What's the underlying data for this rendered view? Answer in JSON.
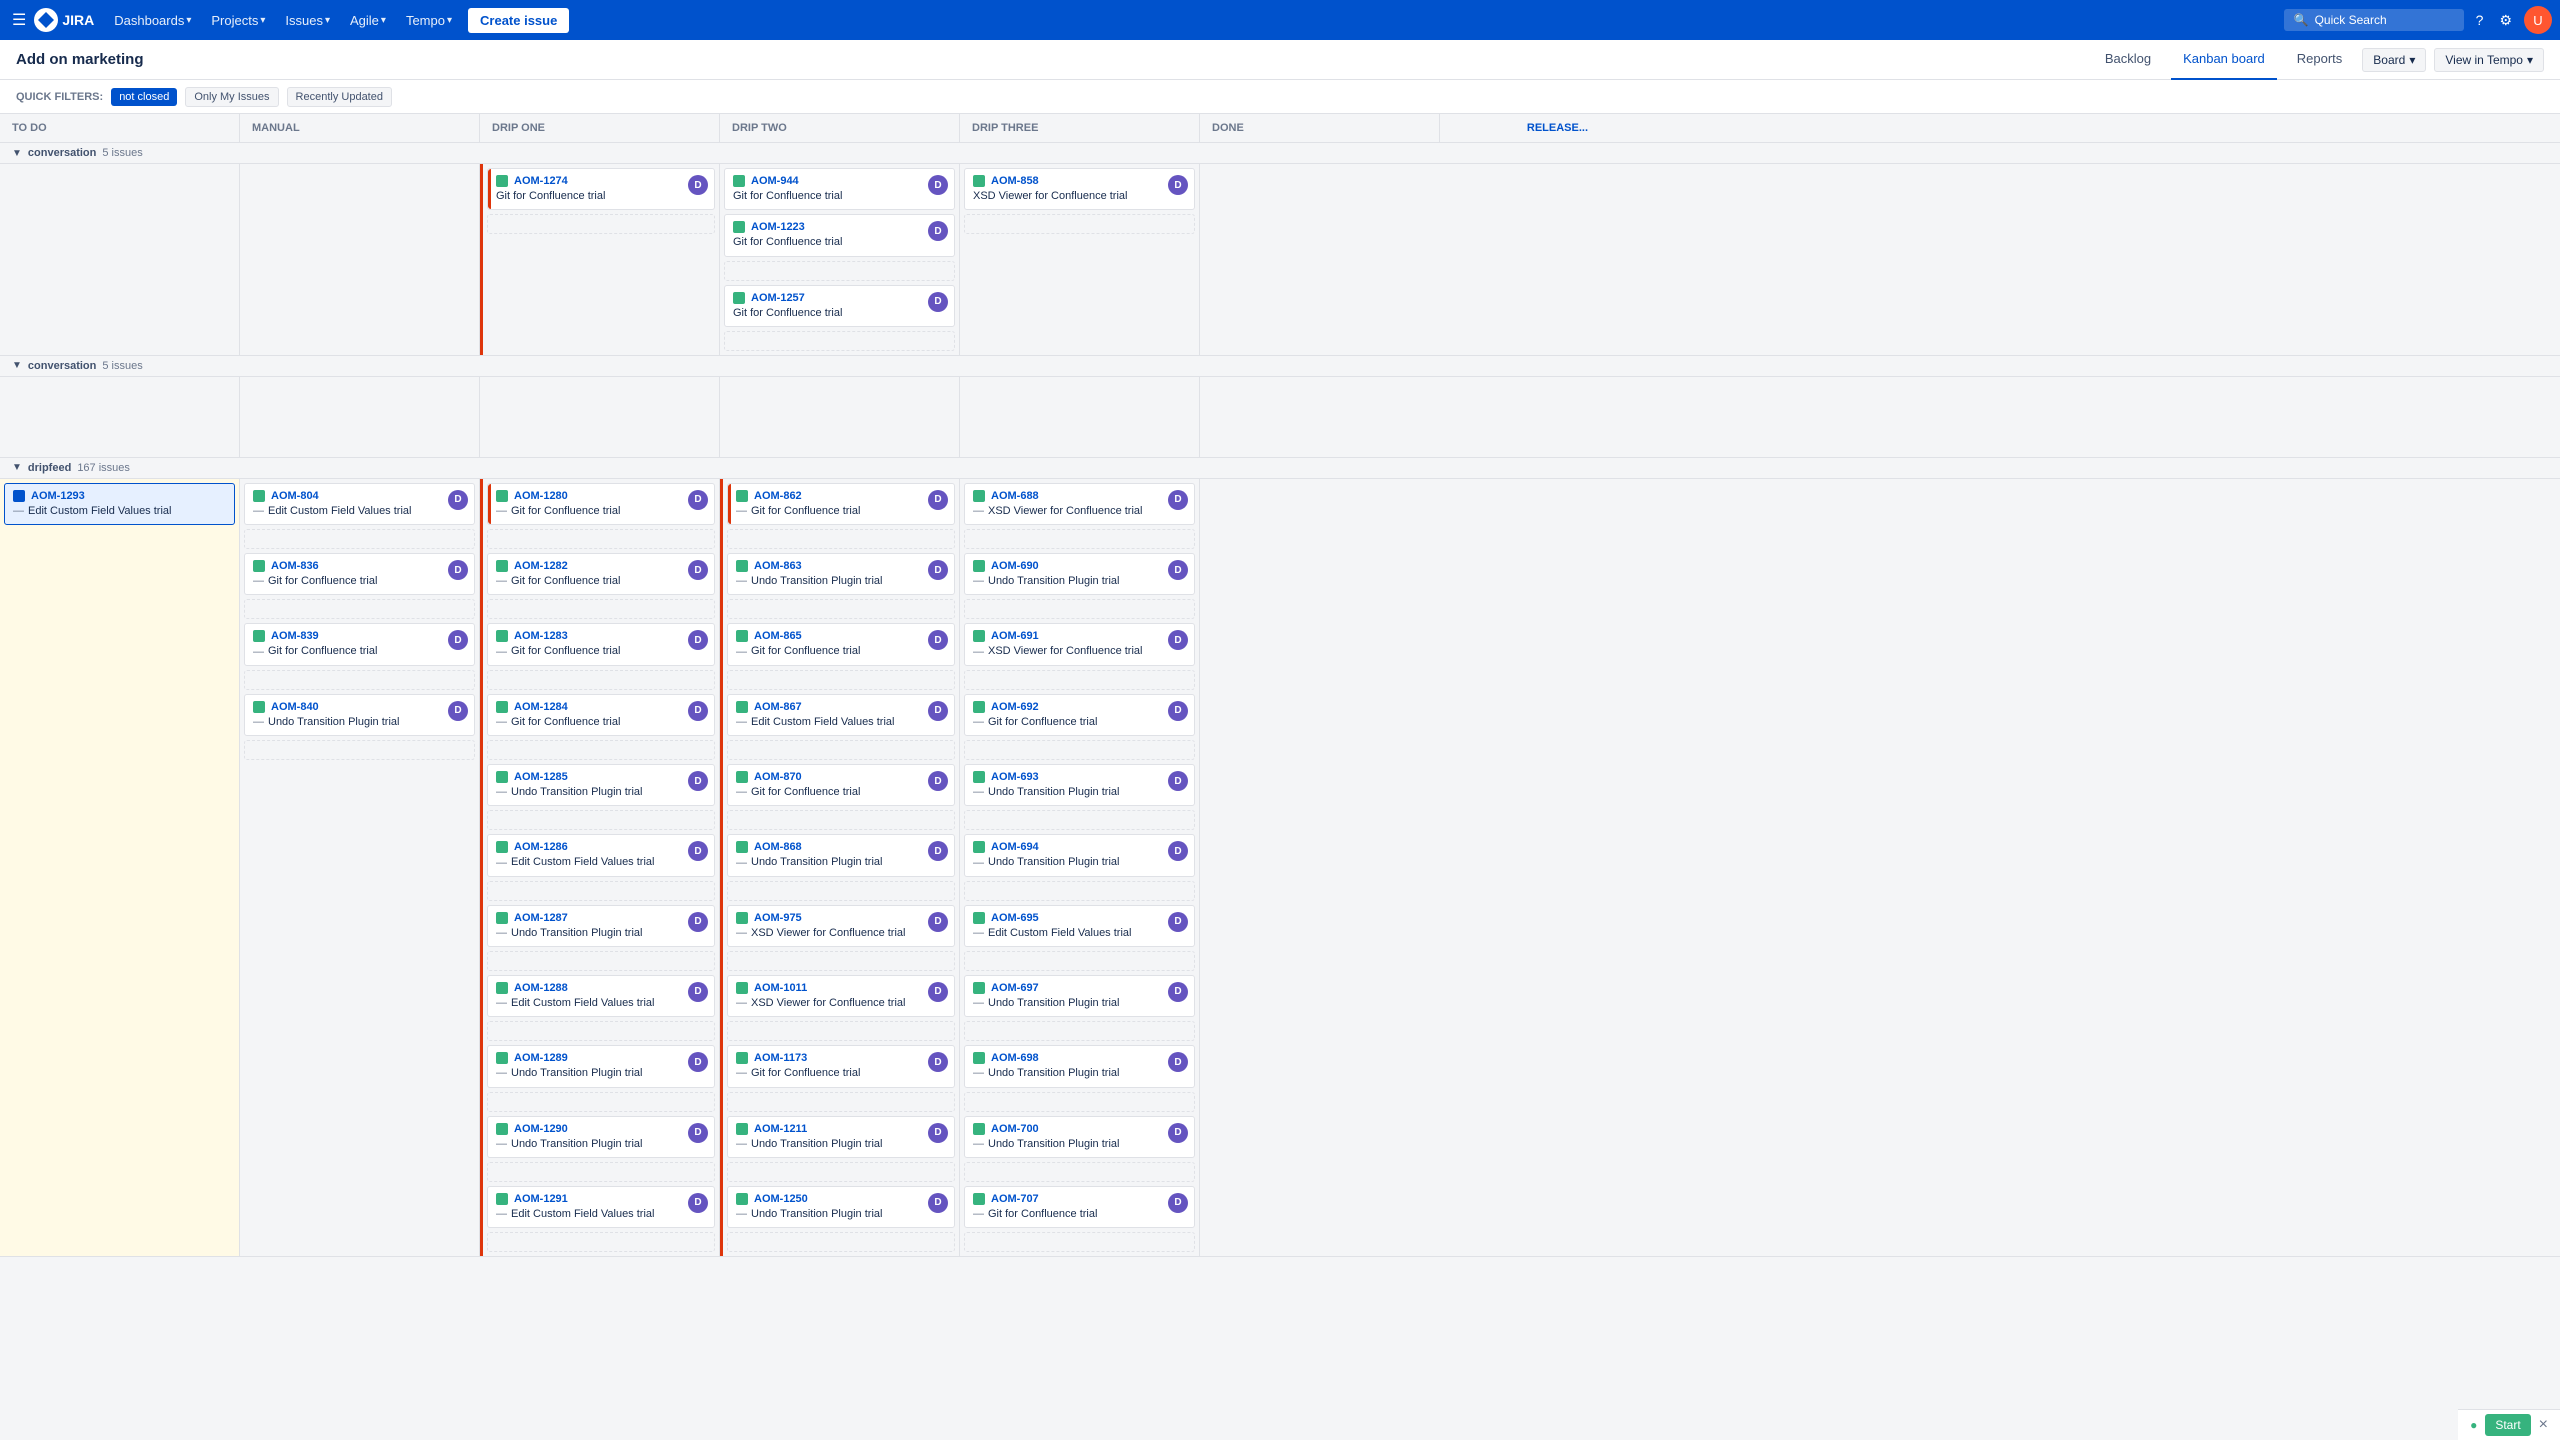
{
  "nav": {
    "logo": "JIRA",
    "dashboards": "Dashboards",
    "projects": "Projects",
    "issues": "Issues",
    "agile": "Agile",
    "tempo": "Tempo",
    "create": "Create issue",
    "search_placeholder": "Quick Search"
  },
  "subNav": {
    "title": "Add on marketing",
    "backlog": "Backlog",
    "kanban": "Kanban board",
    "reports": "Reports",
    "board": "Board",
    "viewTempo": "View in Tempo"
  },
  "quickFilters": {
    "label": "QUICK FILTERS:",
    "notClosed": "not closed",
    "onlyMyIssues": "Only My Issues",
    "recentlyUpdated": "Recently Updated"
  },
  "columns": {
    "headers": [
      "To Do",
      "manual",
      "drip one",
      "drip two",
      "drip three",
      "Done",
      "Release..."
    ]
  },
  "swimlanes": [
    {
      "id": "conversation",
      "label": "conversation",
      "count": "5 issues",
      "collapsed": false,
      "rows": [
        {
          "todo": null,
          "manual": null,
          "dripone": [
            {
              "id": "AOM-1274",
              "title": "Git for Confluence trial",
              "avatar": "D",
              "bar": "red"
            },
            {
              "dashed": true
            }
          ],
          "driptwo": [
            {
              "id": "AOM-944",
              "title": "Git for Confluence trial",
              "avatar": "D"
            },
            {
              "id": "AOM-1223",
              "title": "Git for Confluence trial",
              "avatar": "D"
            },
            {
              "dashed": true
            },
            {
              "id": "AOM-1257",
              "title": "Git for Confluence trial",
              "avatar": "D"
            },
            {
              "dashed": true
            }
          ],
          "dripthree": [
            {
              "id": "AOM-858",
              "title": "XSD Viewer for Confluence trial",
              "avatar": "D"
            },
            {
              "dashed": true
            }
          ],
          "done": null
        }
      ]
    },
    {
      "id": "conversation2",
      "label": "conversation",
      "count": "5 issues",
      "collapsed": false,
      "rows": []
    },
    {
      "id": "dripfeed",
      "label": "dripfeed",
      "count": "167 issues",
      "collapsed": false,
      "rows": [
        {
          "todo_selected": {
            "id": "AOM-1293",
            "title": "Edit Custom Field Values trial",
            "selected": true
          },
          "manual": [
            {
              "id": "AOM-804",
              "title": "Edit Custom Field Values trial",
              "avatar": "D"
            },
            {
              "dashed": true
            },
            {
              "id": "AOM-836",
              "title": "Git for Confluence trial",
              "avatar": "D"
            },
            {
              "dashed": true
            },
            {
              "id": "AOM-839",
              "title": "Git for Confluence trial",
              "avatar": "D"
            },
            {
              "dashed": true
            },
            {
              "id": "AOM-840",
              "title": "Undo Transition Plugin trial",
              "avatar": "D"
            },
            {
              "dashed": true
            }
          ],
          "dripone": [
            {
              "id": "AOM-1280",
              "title": "Git for Confluence trial",
              "avatar": "D",
              "bar": "red"
            },
            {
              "dashed": true
            },
            {
              "id": "AOM-1282",
              "title": "Git for Confluence trial",
              "avatar": "D"
            },
            {
              "dashed": true
            },
            {
              "id": "AOM-1283",
              "title": "Git for Confluence trial",
              "avatar": "D"
            },
            {
              "dashed": true
            },
            {
              "id": "AOM-1284",
              "title": "Git for Confluence trial",
              "avatar": "D"
            },
            {
              "dashed": true
            },
            {
              "id": "AOM-1285",
              "title": "Undo Transition Plugin trial",
              "avatar": "D"
            },
            {
              "dashed": true
            },
            {
              "id": "AOM-1286",
              "title": "Edit Custom Field Values trial",
              "avatar": "D"
            },
            {
              "dashed": true
            },
            {
              "id": "AOM-1287",
              "title": "Undo Transition Plugin trial",
              "avatar": "D"
            },
            {
              "dashed": true
            },
            {
              "id": "AOM-1288",
              "title": "Edit Custom Field Values trial",
              "avatar": "D"
            },
            {
              "dashed": true
            },
            {
              "id": "AOM-1289",
              "title": "Undo Transition Plugin trial",
              "avatar": "D"
            },
            {
              "dashed": true
            },
            {
              "id": "AOM-1290",
              "title": "Undo Transition Plugin trial",
              "avatar": "D"
            },
            {
              "dashed": true
            },
            {
              "id": "AOM-1291",
              "title": "Edit Custom Field Values trial",
              "avatar": "D"
            },
            {
              "dashed": true
            }
          ],
          "driptwo": [
            {
              "id": "AOM-862",
              "title": "Git for Confluence trial",
              "avatar": "D",
              "bar": "red"
            },
            {
              "dashed": true
            },
            {
              "id": "AOM-863",
              "title": "Undo Transition Plugin trial",
              "avatar": "D"
            },
            {
              "dashed": true
            },
            {
              "id": "AOM-865",
              "title": "Git for Confluence trial",
              "avatar": "D"
            },
            {
              "dashed": true
            },
            {
              "id": "AOM-867",
              "title": "Edit Custom Field Values trial",
              "avatar": "D"
            },
            {
              "dashed": true
            },
            {
              "id": "AOM-870",
              "title": "Git for Confluence trial",
              "avatar": "D"
            },
            {
              "dashed": true
            },
            {
              "id": "AOM-868",
              "title": "Undo Transition Plugin trial",
              "avatar": "D"
            },
            {
              "dashed": true
            },
            {
              "id": "AOM-975",
              "title": "XSD Viewer for Confluence trial",
              "avatar": "D"
            },
            {
              "dashed": true
            },
            {
              "id": "AOM-1011",
              "title": "XSD Viewer for Confluence trial",
              "avatar": "D"
            },
            {
              "dashed": true
            },
            {
              "id": "AOM-1173",
              "title": "Git for Confluence trial",
              "avatar": "D"
            },
            {
              "dashed": true
            },
            {
              "id": "AOM-1211",
              "title": "Undo Transition Plugin trial",
              "avatar": "D"
            },
            {
              "dashed": true
            },
            {
              "id": "AOM-1250",
              "title": "Undo Transition Plugin trial",
              "avatar": "D"
            },
            {
              "dashed": true
            }
          ],
          "dripthree": [
            {
              "id": "AOM-688",
              "title": "XSD Viewer for Confluence trial",
              "avatar": "D"
            },
            {
              "dashed": true
            },
            {
              "id": "AOM-690",
              "title": "Undo Transition Plugin trial",
              "avatar": "D"
            },
            {
              "dashed": true
            },
            {
              "id": "AOM-691",
              "title": "XSD Viewer for Confluence trial",
              "avatar": "D"
            },
            {
              "dashed": true
            },
            {
              "id": "AOM-692",
              "title": "Git for Confluence trial",
              "avatar": "D"
            },
            {
              "dashed": true
            },
            {
              "id": "AOM-693",
              "title": "Undo Transition Plugin trial",
              "avatar": "D"
            },
            {
              "dashed": true
            },
            {
              "id": "AOM-694",
              "title": "Undo Transition Plugin trial",
              "avatar": "D"
            },
            {
              "dashed": true
            },
            {
              "id": "AOM-695",
              "title": "Edit Custom Field Values trial",
              "avatar": "D"
            },
            {
              "dashed": true
            },
            {
              "id": "AOM-697",
              "title": "Undo Transition Plugin trial",
              "avatar": "D"
            },
            {
              "dashed": true
            },
            {
              "id": "AOM-698",
              "title": "Undo Transition Plugin trial",
              "avatar": "D"
            },
            {
              "dashed": true
            },
            {
              "id": "AOM-700",
              "title": "Undo Transition Plugin trial",
              "avatar": "D"
            },
            {
              "dashed": true
            },
            {
              "id": "AOM-707",
              "title": "Git for Confluence trial",
              "avatar": "D"
            },
            {
              "dashed": true
            }
          ],
          "done": null
        }
      ]
    }
  ],
  "bottomBar": {
    "start": "Start",
    "close": "×"
  }
}
